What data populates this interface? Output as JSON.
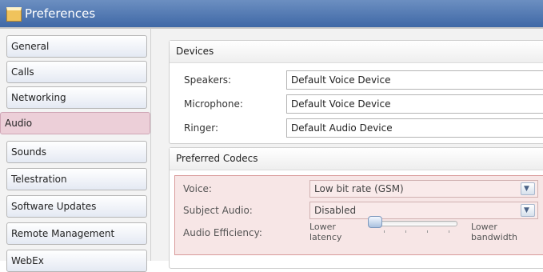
{
  "window": {
    "title": "Preferences",
    "icon": "preferences-icon"
  },
  "sidebar": {
    "items": [
      {
        "label": "General"
      },
      {
        "label": "Calls"
      },
      {
        "label": "Networking"
      },
      {
        "label": "Audio",
        "selected": true
      },
      {
        "label": "Sounds"
      },
      {
        "label": "Telestration"
      },
      {
        "label": "Software Updates"
      },
      {
        "label": "Remote Management"
      },
      {
        "label": "WebEx"
      }
    ]
  },
  "devices": {
    "header": "Devices",
    "speakers_label": "Speakers:",
    "speakers_value": "Default Voice Device",
    "microphone_label": "Microphone:",
    "microphone_value": "Default Voice Device",
    "ringer_label": "Ringer:",
    "ringer_value": "Default Audio Device"
  },
  "codecs": {
    "header": "Preferred Codecs",
    "voice_label": "Voice:",
    "voice_value": "Low bit rate (GSM)",
    "subject_audio_label": "Subject Audio:",
    "subject_audio_value": "Disabled",
    "efficiency_label": "Audio Efficiency:",
    "efficiency_left_1": "Lower",
    "efficiency_left_2": "latency",
    "efficiency_right_1": "Lower",
    "efficiency_right_2": "bandwidth",
    "efficiency_level": 0
  },
  "colors": {
    "titlebar": "#4a72ad",
    "selected_item": "#eccfd8",
    "codec_highlight": "#f7e6e6"
  }
}
